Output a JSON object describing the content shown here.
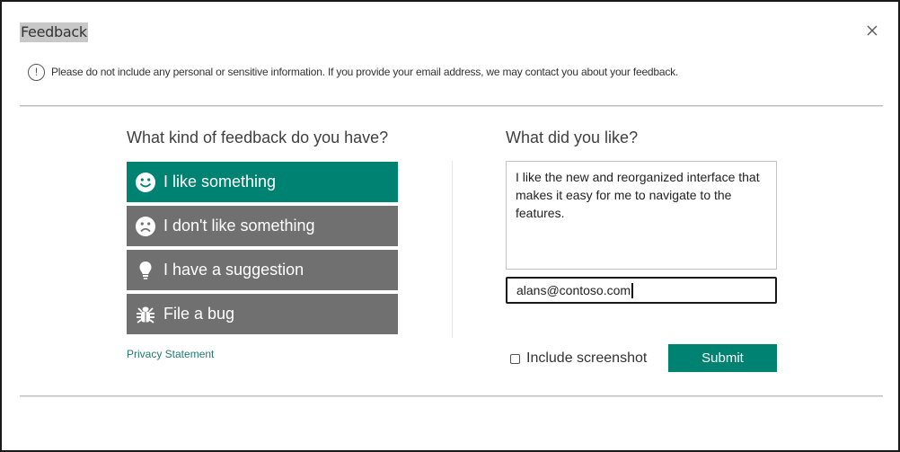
{
  "window": {
    "title": "Feedback",
    "close_icon": "close-icon"
  },
  "notice": {
    "icon": "info-exclamation-icon",
    "text": "Please do not include any personal or sensitive information. If you provide your email address, we may contact you about your feedback."
  },
  "feedback_type": {
    "heading": "What kind of feedback do you have?",
    "options": [
      {
        "label": "I like something",
        "icon": "smile-icon",
        "selected": true
      },
      {
        "label": "I don't like something",
        "icon": "frown-icon",
        "selected": false
      },
      {
        "label": "I have a suggestion",
        "icon": "lightbulb-icon",
        "selected": false
      },
      {
        "label": "File a bug",
        "icon": "bug-icon",
        "selected": false
      }
    ],
    "privacy_link": "Privacy Statement"
  },
  "details": {
    "heading": "What did you like?",
    "comment_value": "I like the new and reorganized interface that makes it easy for me to navigate to the features.",
    "email_value": "alans@contoso.com",
    "include_screenshot_label": "Include screenshot",
    "include_screenshot_checked": false,
    "submit_label": "Submit"
  },
  "colors": {
    "accent": "#008272",
    "unselected_option": "#707070",
    "link": "#227a6e"
  }
}
